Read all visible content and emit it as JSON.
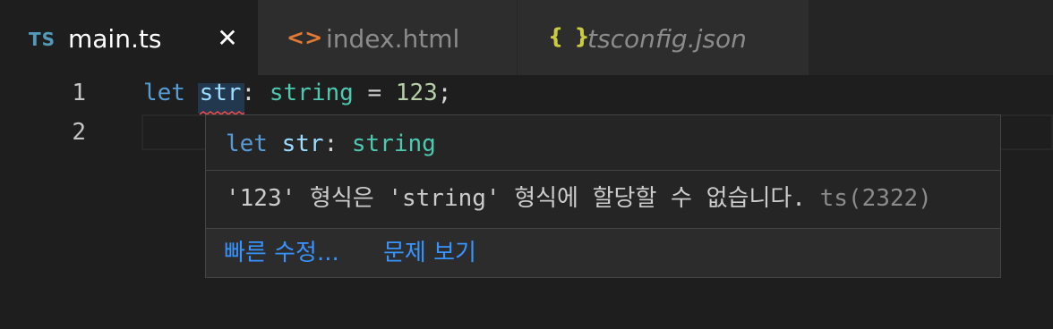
{
  "tabs": [
    {
      "icon": "TS",
      "label": "main.ts",
      "close": "✕"
    },
    {
      "icon": "<>",
      "label": "index.html"
    },
    {
      "icon": "{ }",
      "label": "tsconfig.json"
    }
  ],
  "editor": {
    "line_numbers": [
      "1",
      "2"
    ],
    "line1": {
      "keyword": "let",
      "identifier": "str",
      "colon": ":",
      "type": "string",
      "equals": "=",
      "number": "123",
      "semicolon": ";"
    }
  },
  "hover": {
    "signature": {
      "keyword": "let",
      "identifier": "str",
      "colon": ":",
      "type": "string"
    },
    "message": "'123' 형식은 'string' 형식에 할당할 수 없습니다.",
    "error_code": "ts(2322)",
    "actions": {
      "quick_fix": "빠른 수정...",
      "view_problem": "문제 보기"
    }
  },
  "colors": {
    "background": "#1e1e1e",
    "keyword": "#569cd6",
    "identifier": "#9cdcfe",
    "type": "#4ec9b0",
    "number": "#b5cea8",
    "link": "#3794ff",
    "error_squiggle": "#f14c4c"
  }
}
